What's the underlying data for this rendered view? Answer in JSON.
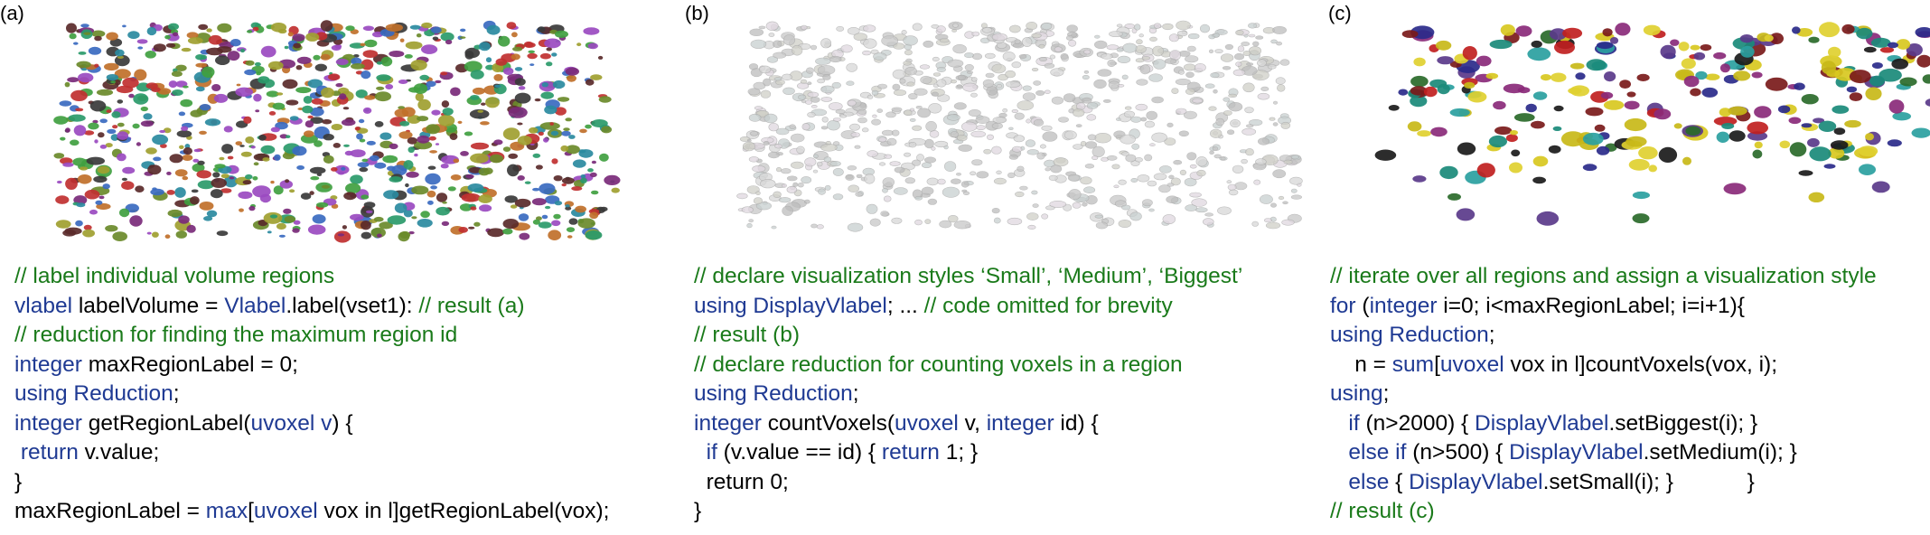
{
  "colors": {
    "comment": "#1a7a1a",
    "keyword": "#1f3a93",
    "text": "#000000",
    "panel_a_palette": [
      "#7a2a7a",
      "#2a9a6a",
      "#c03030",
      "#3a6ac0",
      "#6a8a2a",
      "#c0702a",
      "#3a3a3a",
      "#9a4ac0",
      "#2a8aa0",
      "#a0a030",
      "#5a2a2a",
      "#40a040"
    ],
    "panel_b_palette": [
      "#d8d8d8",
      "#c8c8c8",
      "#e0d8e0",
      "#d0d0c8",
      "#c8d0d0",
      "#bdbdbd"
    ],
    "panel_c_palette": [
      "#d8c820",
      "#c8b818",
      "#e0d030",
      "#1a1a1a",
      "#2a2a8a",
      "#7a1a1a",
      "#1a8a7a",
      "#8a2a7a",
      "#c02020",
      "#2a6a2a",
      "#5a3a8a",
      "#2aa0a0"
    ]
  },
  "panels": [
    {
      "label": "(a)",
      "image": "labeled-volume-regions-all-colored",
      "code": [
        [
          [
            "cm",
            "// label individual volume regions"
          ]
        ],
        [
          [
            "kw",
            "vlabel"
          ],
          [
            "tx",
            " labelVolume = "
          ],
          [
            "kw",
            "Vlabel"
          ],
          [
            "tx",
            ".label(vset1): "
          ],
          [
            "cm",
            "// result (a)"
          ]
        ],
        [
          [
            "cm",
            "// reduction for finding the maximum region id"
          ]
        ],
        [
          [
            "kw",
            "integer"
          ],
          [
            "tx",
            " maxRegionLabel = 0;"
          ]
        ],
        [
          [
            "kw",
            "using Reduction"
          ],
          [
            "tx",
            ";"
          ]
        ],
        [
          [
            "kw",
            "integer"
          ],
          [
            "tx",
            " getRegionLabel("
          ],
          [
            "kw",
            "uvoxel v"
          ],
          [
            "tx",
            ") {"
          ]
        ],
        [
          [
            "tx",
            " "
          ],
          [
            "kw",
            "return"
          ],
          [
            "tx",
            " v.value;"
          ]
        ],
        [
          [
            "tx",
            "}"
          ]
        ],
        [
          [
            "tx",
            "maxRegionLabel = "
          ],
          [
            "kw",
            "max"
          ],
          [
            "tx",
            "["
          ],
          [
            "kw",
            "uvoxel"
          ],
          [
            "tx",
            " vox in l]getRegionLabel(vox);"
          ]
        ]
      ]
    },
    {
      "label": "(b)",
      "image": "regions-with-default-gray-style",
      "code": [
        [
          [
            "cm",
            "// declare visualization styles ‘Small’, ‘Medium’, ‘Biggest’"
          ]
        ],
        [
          [
            "kw",
            "using DisplayVlabel"
          ],
          [
            "tx",
            "; ... "
          ],
          [
            "cm",
            "// code omitted for brevity"
          ]
        ],
        [
          [
            "cm",
            "// result (b)"
          ]
        ],
        [
          [
            "cm",
            "// declare reduction for counting voxels in a region"
          ]
        ],
        [
          [
            "kw",
            "using Reduction"
          ],
          [
            "tx",
            ";"
          ]
        ],
        [
          [
            "kw",
            "integer"
          ],
          [
            "tx",
            " countVoxels("
          ],
          [
            "kw",
            "uvoxel"
          ],
          [
            "tx",
            " v, "
          ],
          [
            "kw",
            "integer"
          ],
          [
            "tx",
            " id) {"
          ]
        ],
        [
          [
            "tx",
            "  "
          ],
          [
            "kw",
            "if"
          ],
          [
            "tx",
            " (v.value == id) { "
          ],
          [
            "kw",
            "return"
          ],
          [
            "tx",
            " 1; }"
          ]
        ],
        [
          [
            "tx",
            "  return 0;"
          ]
        ],
        [
          [
            "tx",
            "}"
          ]
        ]
      ]
    },
    {
      "label": "(c)",
      "image": "regions-styled-by-size",
      "code": [
        [
          [
            "cm",
            "// iterate over all regions and assign a visualization style"
          ]
        ],
        [
          [
            "kw",
            "for"
          ],
          [
            "tx",
            " ("
          ],
          [
            "kw",
            "integer"
          ],
          [
            "tx",
            " i=0; i<maxRegionLabel; i=i+1){"
          ]
        ],
        [
          [
            "kw",
            "using Reduction"
          ],
          [
            "tx",
            ";"
          ]
        ],
        [
          [
            "tx",
            "    n = "
          ],
          [
            "kw",
            "sum"
          ],
          [
            "tx",
            "["
          ],
          [
            "kw",
            "uvoxel"
          ],
          [
            "tx",
            " vox in l]countVoxels(vox, i);"
          ]
        ],
        [
          [
            "kw",
            "using"
          ],
          [
            "tx",
            ";"
          ]
        ],
        [
          [
            "tx",
            "   "
          ],
          [
            "kw",
            "if"
          ],
          [
            "tx",
            " (n>2000) { "
          ],
          [
            "kw",
            "DisplayVlabel"
          ],
          [
            "tx",
            ".setBiggest(i); }"
          ]
        ],
        [
          [
            "tx",
            "   "
          ],
          [
            "kw",
            "else if"
          ],
          [
            "tx",
            " (n>500) { "
          ],
          [
            "kw",
            "DisplayVlabel"
          ],
          [
            "tx",
            ".setMedium(i); }"
          ]
        ],
        [
          [
            "tx",
            "   "
          ],
          [
            "kw",
            "else"
          ],
          [
            "tx",
            " { "
          ],
          [
            "kw",
            "DisplayVlabel"
          ],
          [
            "tx",
            ".setSmall(i); }            }"
          ]
        ],
        [
          [
            "cm",
            "// result (c)"
          ]
        ]
      ]
    }
  ]
}
